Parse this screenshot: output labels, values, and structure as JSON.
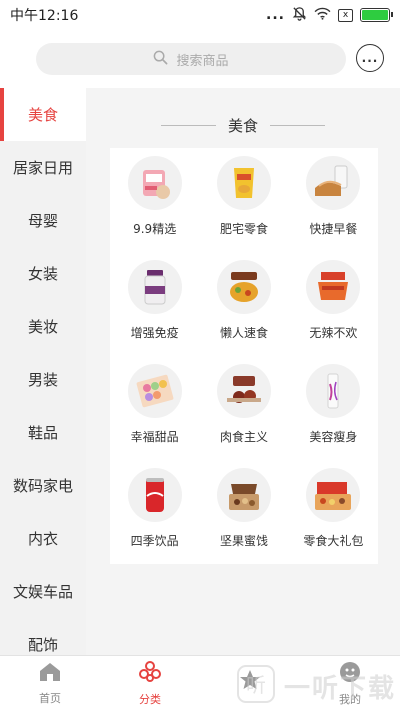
{
  "status_bar": {
    "time": "中午12:16",
    "dots": "...",
    "sim_badge": "x"
  },
  "search": {
    "placeholder": "搜索商品"
  },
  "chat_dots": "...",
  "sidebar": {
    "items": [
      {
        "label": "美食"
      },
      {
        "label": "居家日用"
      },
      {
        "label": "母婴"
      },
      {
        "label": "女装"
      },
      {
        "label": "美妆"
      },
      {
        "label": "男装"
      },
      {
        "label": "鞋品"
      },
      {
        "label": "数码家电"
      },
      {
        "label": "内衣"
      },
      {
        "label": "文娱车品"
      },
      {
        "label": "配饰"
      }
    ],
    "active_index": 0
  },
  "section": {
    "title": "美食"
  },
  "categories": [
    {
      "label": "9.9精选",
      "icon": "snack-pack-icon"
    },
    {
      "label": "肥宅零食",
      "icon": "chips-bag-icon"
    },
    {
      "label": "快捷早餐",
      "icon": "bread-milk-icon"
    },
    {
      "label": "增强免疫",
      "icon": "supplement-jar-icon"
    },
    {
      "label": "懒人速食",
      "icon": "instant-meal-icon"
    },
    {
      "label": "无辣不欢",
      "icon": "spicy-snack-icon"
    },
    {
      "label": "幸福甜品",
      "icon": "macaron-icon"
    },
    {
      "label": "肉食主义",
      "icon": "meat-snack-icon"
    },
    {
      "label": "美容瘦身",
      "icon": "beauty-drink-icon"
    },
    {
      "label": "四季饮品",
      "icon": "cola-can-icon"
    },
    {
      "label": "坚果蜜饯",
      "icon": "nut-box-icon"
    },
    {
      "label": "零食大礼包",
      "icon": "gift-box-icon"
    }
  ],
  "tabbar": {
    "tabs": [
      {
        "label": "首页",
        "icon": "home-icon"
      },
      {
        "label": "分类",
        "icon": "category-icon"
      },
      {
        "label": "",
        "icon": "star-icon"
      },
      {
        "label": "我的",
        "icon": "profile-icon"
      }
    ],
    "active_index": 1
  },
  "watermark": {
    "text": "一听下载",
    "logo_text": "听"
  },
  "colors": {
    "accent": "#e64340",
    "sidebar_bg": "#f2f2f2",
    "content_bg": "#f4f4f4",
    "battery": "#2ecc40"
  }
}
